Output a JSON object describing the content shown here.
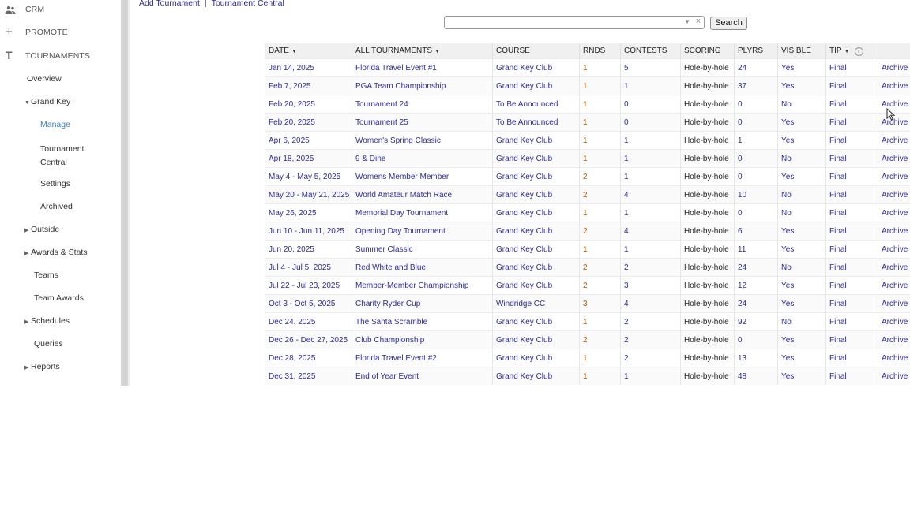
{
  "sidebar": {
    "top": [
      {
        "label": "CRM",
        "icon": "people-icon"
      },
      {
        "label": "PROMOTE",
        "icon": "plus-icon"
      },
      {
        "label": "TOURNAMENTS",
        "icon": "t-icon"
      }
    ],
    "overview": "Overview",
    "grand_key": "Grand Key",
    "manage": "Manage",
    "tournament_central_1": "Tournament",
    "tournament_central_2": "Central",
    "settings": "Settings",
    "archived": "Archived",
    "outside": "Outside",
    "awards_stats": "Awards & Stats",
    "teams": "Teams",
    "team_awards": "Team Awards",
    "schedules": "Schedules",
    "queries": "Queries",
    "reports": "Reports"
  },
  "toplinks": {
    "add": "Add Tournament",
    "separator": "|",
    "central": "Tournament Central"
  },
  "search": {
    "value": "",
    "button": "Search"
  },
  "table": {
    "headers": {
      "date": "DATE",
      "tournaments": "ALL TOURNAMENTS",
      "course": "COURSE",
      "rnds": "RNDS",
      "contests": "CONTESTS",
      "scoring": "SCORING",
      "plyrs": "PLYRS",
      "visible": "VISIBLE",
      "tip": "TIP"
    },
    "rows": [
      {
        "date": "Jan 14, 2025",
        "name": "Florida Travel Event #1",
        "course": "Grand Key Club",
        "rnds": "1",
        "contests": "5",
        "scoring": "Hole-by-hole",
        "plyrs": "24",
        "visible": "Yes",
        "tip": "Final",
        "action": "Archive"
      },
      {
        "date": "Feb 7, 2025",
        "name": "PGA Team Championship",
        "course": "Grand Key Club",
        "rnds": "1",
        "contests": "1",
        "scoring": "Hole-by-hole",
        "plyrs": "37",
        "visible": "Yes",
        "tip": "Final",
        "action": "Archive"
      },
      {
        "date": "Feb 20, 2025",
        "name": "Tournament 24",
        "course": "To Be Announced",
        "rnds": "1",
        "contests": "0",
        "scoring": "Hole-by-hole",
        "plyrs": "0",
        "visible": "No",
        "tip": "Final",
        "action": "Archive"
      },
      {
        "date": "Feb 20, 2025",
        "name": "Tournament 25",
        "course": "To Be Announced",
        "rnds": "1",
        "contests": "0",
        "scoring": "Hole-by-hole",
        "plyrs": "0",
        "visible": "Yes",
        "tip": "Final",
        "action": "Archive"
      },
      {
        "date": "Apr 6, 2025",
        "name": "Women's Spring Classic",
        "course": "Grand Key Club",
        "rnds": "1",
        "contests": "1",
        "scoring": "Hole-by-hole",
        "plyrs": "1",
        "visible": "Yes",
        "tip": "Final",
        "action": "Archive"
      },
      {
        "date": "Apr 18, 2025",
        "name": "9 & Dine",
        "course": "Grand Key Club",
        "rnds": "1",
        "contests": "1",
        "scoring": "Hole-by-hole",
        "plyrs": "0",
        "visible": "No",
        "tip": "Final",
        "action": "Archive"
      },
      {
        "date": "May 4 - May 5, 2025",
        "name": "Womens Member Member",
        "course": "Grand Key Club",
        "rnds": "2",
        "contests": "1",
        "scoring": "Hole-by-hole",
        "plyrs": "0",
        "visible": "Yes",
        "tip": "Final",
        "action": "Archive"
      },
      {
        "date": "May 20 - May 21, 2025",
        "name": "World Amateur Match Race",
        "course": "Grand Key Club",
        "rnds": "2",
        "contests": "4",
        "scoring": "Hole-by-hole",
        "plyrs": "10",
        "visible": "No",
        "tip": "Final",
        "action": "Archive"
      },
      {
        "date": "May 26, 2025",
        "name": "Memorial Day Tournament",
        "course": "Grand Key Club",
        "rnds": "1",
        "contests": "1",
        "scoring": "Hole-by-hole",
        "plyrs": "0",
        "visible": "No",
        "tip": "Final",
        "action": "Archive"
      },
      {
        "date": "Jun 10 - Jun 11, 2025",
        "name": "Opening Day Tournament",
        "course": "Grand Key Club",
        "rnds": "2",
        "contests": "4",
        "scoring": "Hole-by-hole",
        "plyrs": "6",
        "visible": "Yes",
        "tip": "Final",
        "action": "Archive"
      },
      {
        "date": "Jun 20, 2025",
        "name": "Summer Classic",
        "course": "Grand Key Club",
        "rnds": "1",
        "contests": "1",
        "scoring": "Hole-by-hole",
        "plyrs": "11",
        "visible": "Yes",
        "tip": "Final",
        "action": "Archive"
      },
      {
        "date": "Jul 4 - Jul 5, 2025",
        "name": "Red White and Blue",
        "course": "Grand Key Club",
        "rnds": "2",
        "contests": "2",
        "scoring": "Hole-by-hole",
        "plyrs": "24",
        "visible": "No",
        "tip": "Final",
        "action": "Archive"
      },
      {
        "date": "Jul 22 - Jul 23, 2025",
        "name": "Member-Member Championship",
        "course": "Grand Key Club",
        "rnds": "2",
        "contests": "3",
        "scoring": "Hole-by-hole",
        "plyrs": "12",
        "visible": "Yes",
        "tip": "Final",
        "action": "Archive"
      },
      {
        "date": "Oct 3 - Oct 5, 2025",
        "name": "Charity Ryder Cup",
        "course": "Windridge CC",
        "rnds": "3",
        "contests": "4",
        "scoring": "Hole-by-hole",
        "plyrs": "24",
        "visible": "Yes",
        "tip": "Final",
        "action": "Archive"
      },
      {
        "date": "Dec 24, 2025",
        "name": "The Santa Scramble",
        "course": "Grand Key Club",
        "rnds": "1",
        "contests": "2",
        "scoring": "Hole-by-hole",
        "plyrs": "92",
        "visible": "No",
        "tip": "Final",
        "action": "Archive"
      },
      {
        "date": "Dec 26 - Dec 27, 2025",
        "name": "Club Championship",
        "course": "Grand Key Club",
        "rnds": "2",
        "contests": "2",
        "scoring": "Hole-by-hole",
        "plyrs": "0",
        "visible": "Yes",
        "tip": "Final",
        "action": "Archive"
      },
      {
        "date": "Dec 28, 2025",
        "name": "Florida Travel Event #2",
        "course": "Grand Key Club",
        "rnds": "1",
        "contests": "2",
        "scoring": "Hole-by-hole",
        "plyrs": "13",
        "visible": "Yes",
        "tip": "Final",
        "action": "Archive"
      },
      {
        "date": "Dec 31, 2025",
        "name": "End of Year Event",
        "course": "Grand Key Club",
        "rnds": "1",
        "contests": "1",
        "scoring": "Hole-by-hole",
        "plyrs": "48",
        "visible": "Yes",
        "tip": "Final",
        "action": "Archive"
      }
    ]
  }
}
